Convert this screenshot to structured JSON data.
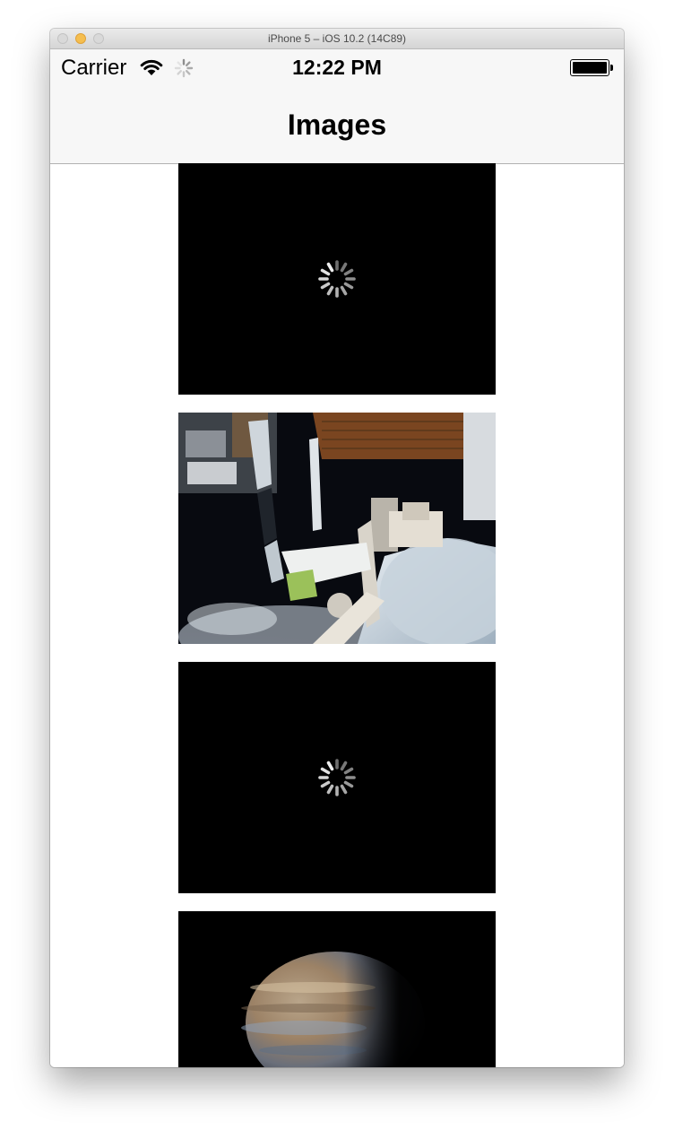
{
  "window": {
    "title": "iPhone 5 – iOS 10.2 (14C89)"
  },
  "status_bar": {
    "carrier": "Carrier",
    "time": "12:22 PM"
  },
  "nav_bar": {
    "title": "Images"
  },
  "images": [
    {
      "state": "loading"
    },
    {
      "state": "loaded",
      "subject": "space station over earth"
    },
    {
      "state": "loading"
    },
    {
      "state": "loaded",
      "subject": "planet jupiter"
    }
  ],
  "icons": [
    "wifi-icon",
    "activity-indicator-icon",
    "battery-icon",
    "loading-spinner-icon"
  ],
  "colors": {
    "chrome_bg": "#f7f7f7",
    "image_bg": "#000000",
    "traffic_min": "#f5be4f"
  }
}
